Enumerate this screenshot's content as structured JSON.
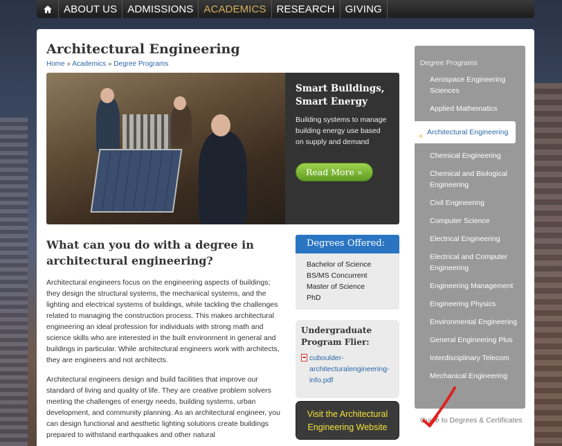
{
  "nav": {
    "items": [
      {
        "label": "ABOUT US",
        "active": false
      },
      {
        "label": "ADMISSIONS",
        "active": false
      },
      {
        "label": "ACADEMICS",
        "active": true
      },
      {
        "label": "RESEARCH",
        "active": false
      },
      {
        "label": "GIVING",
        "active": false
      }
    ],
    "home_icon": "home-icon"
  },
  "page": {
    "title": "Architectural Engineering",
    "breadcrumb": [
      "Home",
      "Academics",
      "Degree Programs"
    ],
    "breadcrumb_sep": "»"
  },
  "hero": {
    "title": "Smart Buildings, Smart Energy",
    "description": "Building systems to manage building energy use based on supply and demand",
    "button": "Read More »"
  },
  "article": {
    "heading": "What can you do with a degree in architectural engineering?",
    "paragraphs": [
      "Architectural engineers focus on the engineering aspects of buildings; they design the structural systems, the mechanical systems, and the lighting and electrical systems of buildings, while tackling the challenges related to managing the construction process. This makes architectural engineering an ideal profession for individuals with strong math and science skills who are interested in the built environment in general and buildings in particular. While architectural engineers work with architects, they are engineers and not architects.",
      "Architectural engineers design and build facilities that improve our standard of living and quality of life. They are creative problem solvers meeting the challenges of energy needs, building systems, urban development, and community planning.  As an architectural engineer, you can design functional and aesthetic lighting solutions create buildings prepared to withstand earthquakes and other natural"
    ]
  },
  "degrees": {
    "heading": "Degrees Offered:",
    "items": [
      "Bachelor of Science",
      "BS/MS Concurrent",
      "Master of Science",
      "PhD"
    ]
  },
  "flier": {
    "heading": "Undergraduate Program Flier:",
    "link": "cuboulder-architecturalengineering-info.pdf"
  },
  "visit": {
    "label": "Visit the Architectural Engineering Website"
  },
  "sidebar": {
    "section_title": "Degree Programs",
    "items": [
      "Aerospace Engineering Sciences",
      "Applied Mathematics",
      "Architectural Engineering",
      "Chemical Engineering",
      "Chemical and Biological Engineering",
      "Civil Engineering",
      "Computer Science",
      "Electrical Engineering",
      "Electrical and Computer Engineering",
      "Engineering Management",
      "Engineering Physics",
      "Environmental Engineering",
      "General Engineering Plus",
      "Interdisciplinary Telecom",
      "Mechanical Engineering"
    ],
    "active_index": 2,
    "active_chevron": "»",
    "extra": "Guide to Degrees & Certificates"
  },
  "colors": {
    "accent_blue": "#2a75c2",
    "link": "#2a67a8",
    "nav_active": "#d4b060",
    "visit_text": "#f4e23a",
    "read_more": "#6fae2c",
    "annotation_arrow": "#e02020"
  }
}
